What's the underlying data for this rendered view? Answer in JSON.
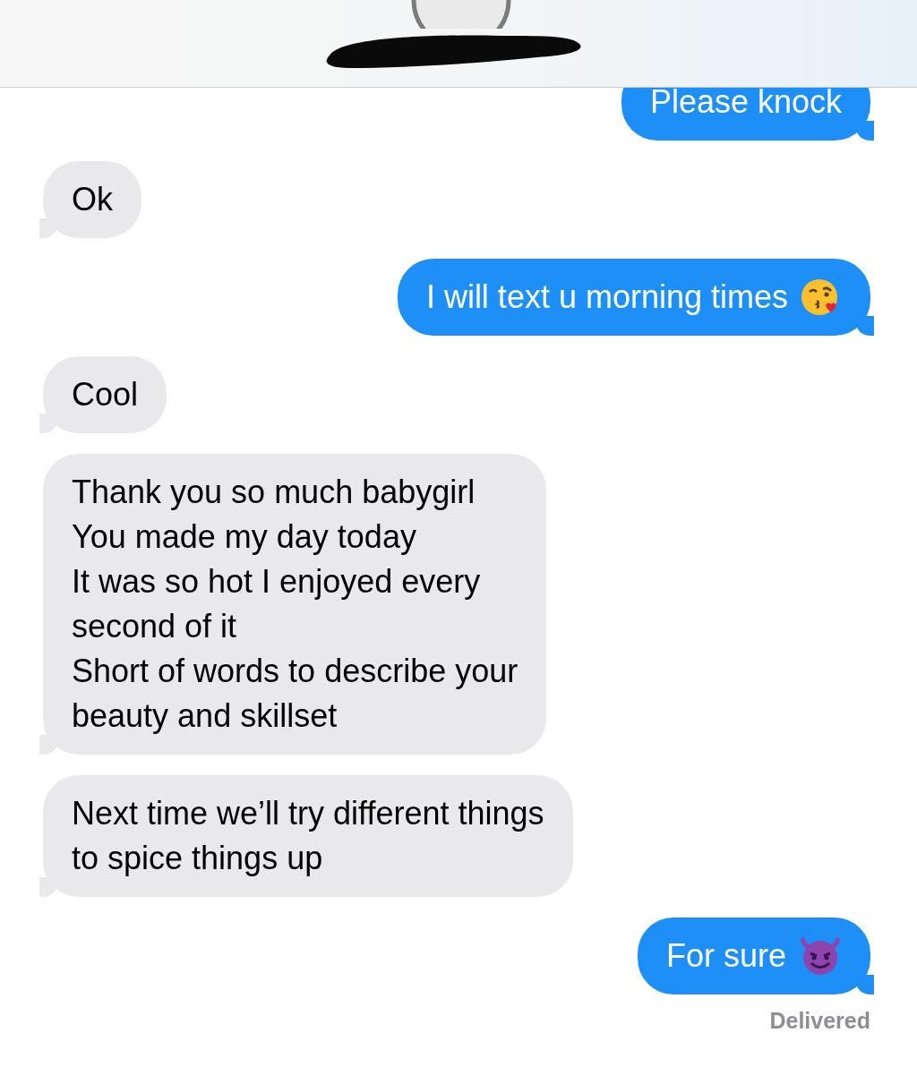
{
  "messages": [
    {
      "kind": "sent",
      "text": "Please knock"
    },
    {
      "kind": "received",
      "text": "Ok"
    },
    {
      "kind": "sent",
      "text": "I will text u morning times",
      "icon": {
        "kind": "kiss"
      }
    },
    {
      "kind": "received",
      "text": "Cool"
    },
    {
      "kind": "received",
      "text": "Thank you so much babygirl\nYou made my day today\nIt was so hot I enjoyed every\nsecond of it\nShort of words to describe your\nbeauty and skillset"
    },
    {
      "kind": "received",
      "text": "Next time we’ll try different things\nto spice things up"
    },
    {
      "kind": "sent",
      "text": "For sure",
      "icon": {
        "kind": "devil"
      }
    }
  ],
  "status": "Delivered"
}
